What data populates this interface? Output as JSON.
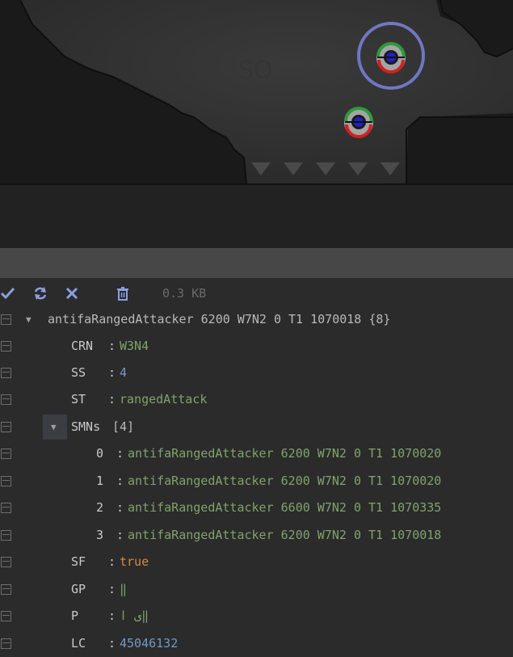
{
  "toolbar": {
    "icons": [
      "check-icon",
      "refresh-icon",
      "close-icon",
      "trash-icon"
    ],
    "size_label": "0.3 KB"
  },
  "root": {
    "label": "antifaRangedAttacker 6200 W7N2 0 T1 1070018 {8}"
  },
  "fields": {
    "crn": {
      "key": "CRN",
      "value": "W3N4"
    },
    "ss": {
      "key": "SS",
      "value": "4"
    },
    "st": {
      "key": "ST",
      "value": "rangedAttack"
    },
    "smns": {
      "key": "SMNs",
      "count": "[4]",
      "items": [
        {
          "index": "0",
          "value": "antifaRangedAttacker 6200 W7N2 0 T1 1070020"
        },
        {
          "index": "1",
          "value": "antifaRangedAttacker 6200 W7N2 0 T1 1070020"
        },
        {
          "index": "2",
          "value": "antifaRangedAttacker 6600 W7N2 0 T1 1070335"
        },
        {
          "index": "3",
          "value": "antifaRangedAttacker 6200 W7N2 0 T1 1070018"
        }
      ]
    },
    "sf": {
      "key": "SF",
      "value": "true"
    },
    "gp": {
      "key": "GP",
      "value": "‖"
    },
    "p": {
      "key": "P",
      "value": "ی ا‖"
    },
    "lc": {
      "key": "LC",
      "value": "45046132"
    }
  },
  "colors": {
    "string": "#7fa36b",
    "number": "#6f9ac8",
    "boolean": "#d48a43",
    "toolbar_icon": "#8aa0e0"
  }
}
